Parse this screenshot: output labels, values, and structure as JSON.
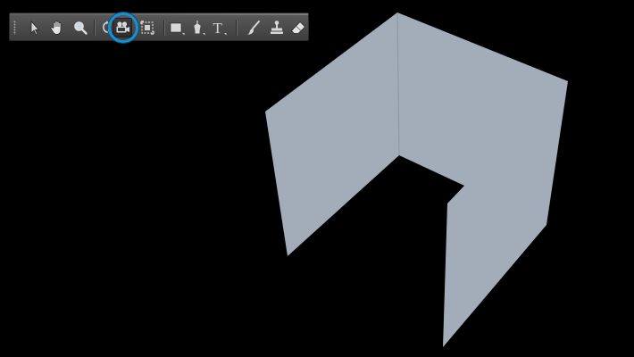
{
  "toolbar": {
    "tools": [
      {
        "name": "move-tool",
        "icon": "arrow-cursor-icon"
      },
      {
        "name": "hand-tool",
        "icon": "hand-icon"
      },
      {
        "name": "zoom-tool",
        "icon": "magnifier-icon"
      },
      {
        "name": "rotate-3d-tool",
        "icon": "rotate-3d-icon"
      },
      {
        "name": "camera-tool",
        "icon": "video-camera-icon",
        "active": true
      },
      {
        "name": "scale-3d-tool",
        "icon": "scale-3d-icon"
      },
      {
        "name": "rectangle-tool",
        "icon": "rectangle-icon"
      },
      {
        "name": "pen-tool",
        "icon": "pen-nib-icon"
      },
      {
        "name": "text-tool",
        "icon": "text-t-icon",
        "glyph": "T"
      },
      {
        "name": "brush-tool",
        "icon": "brush-icon"
      },
      {
        "name": "stamp-tool",
        "icon": "stamp-icon"
      },
      {
        "name": "eraser-tool",
        "icon": "eraser-icon"
      }
    ],
    "highlight_color": "#1a8fd0"
  },
  "stage": {
    "background_color": "#000000",
    "object_color": "#a3adba",
    "object": "3d-three-walled-box"
  }
}
